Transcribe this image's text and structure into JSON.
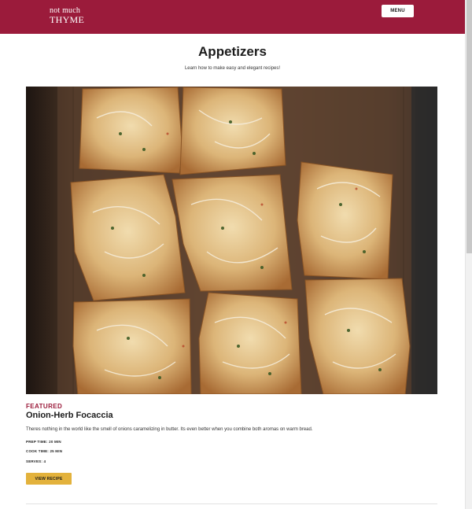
{
  "header": {
    "logo_line1": "not much",
    "logo_line2": "THYME",
    "menu_label": "MENU",
    "brand_color": "#9b1b3b"
  },
  "page": {
    "title": "Appetizers",
    "subtitle": "Learn how to make easy and elegant recipes!"
  },
  "featured": {
    "label": "FEATURED",
    "title": "Onion-Herb Focaccia",
    "description": "Theres nothing in the world like the smell of onions caramelizing in butter. Its even better when you combine both aromas on warm bread.",
    "prep_time": "PREP TIME: 20 MIN",
    "cook_time": "COOK TIME: 25 MIN",
    "serves": "SERVES: 4",
    "button_label": "VIEW RECIPE",
    "button_color": "#e3b23c"
  }
}
